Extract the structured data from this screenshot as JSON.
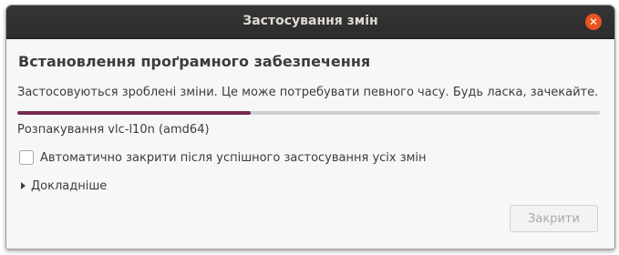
{
  "window": {
    "title": "Застосування змін"
  },
  "main": {
    "heading": "Встановлення проґрамного забезпечення",
    "description": "Застосовуються зроблені зміни. Це може потребувати певного часу. Будь ласка, зачекайте.",
    "progress_fraction": 0.4,
    "status": "Розпакування vlc-l10n (amd64)",
    "auto_close_checkbox": {
      "label": "Автоматично закрити після успішного застосування усіх змін",
      "checked": false
    },
    "details_label": "Докладніше",
    "close_button_label": "Закрити"
  },
  "colors": {
    "accent": "#e95420",
    "progress": "#772953",
    "titlebar": "#2c2c2c"
  }
}
